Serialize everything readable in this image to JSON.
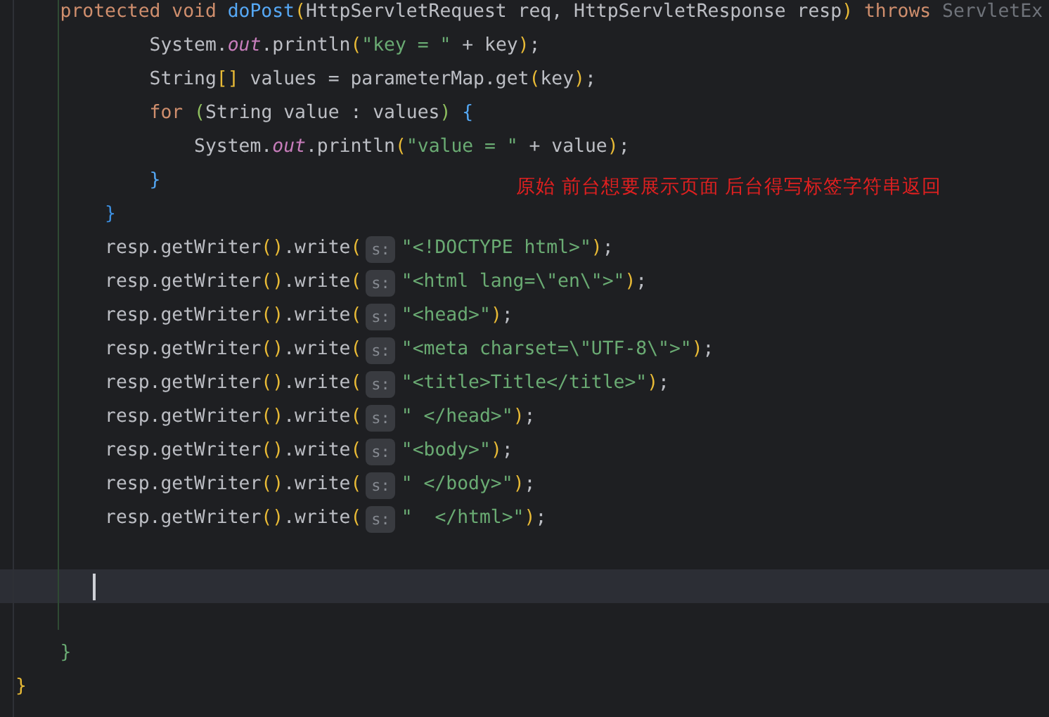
{
  "editor": {
    "lines": [
      {
        "kind": "code",
        "segments": [
          {
            "kind": "code",
            "tokens": [
              {
                "t": "    protected void ",
                "kind": "keyword"
              },
              {
                "t": "doPost",
                "kind": "method"
              },
              {
                "t": "(",
                "kind": "paren"
              },
              {
                "t": "HttpServletRequest req, HttpServletResponse resp",
                "kind": "plain"
              },
              {
                "t": ")",
                "kind": "paren"
              },
              {
                "t": " throws ",
                "kind": "keyword"
              },
              {
                "t": "ServletEx",
                "kind": "dim"
              }
            ]
          }
        ]
      },
      {
        "kind": "code",
        "segments": [
          {
            "kind": "code",
            "tokens": [
              {
                "t": "            System.",
                "kind": "plain"
              },
              {
                "t": "out",
                "kind": "field"
              },
              {
                "t": ".println",
                "kind": "plain"
              },
              {
                "t": "(",
                "kind": "paren"
              },
              {
                "t": "\"key = \"",
                "kind": "string"
              },
              {
                "t": " + key",
                "kind": "plain"
              },
              {
                "t": ")",
                "kind": "paren"
              },
              {
                "t": ";",
                "kind": "plain"
              }
            ]
          }
        ]
      },
      {
        "kind": "code",
        "segments": [
          {
            "kind": "code",
            "tokens": [
              {
                "t": "            String",
                "kind": "plain"
              },
              {
                "t": "[]",
                "kind": "paren"
              },
              {
                "t": " values = parameterMap.get",
                "kind": "plain"
              },
              {
                "t": "(",
                "kind": "paren"
              },
              {
                "t": "key",
                "kind": "plain"
              },
              {
                "t": ")",
                "kind": "paren"
              },
              {
                "t": ";",
                "kind": "plain"
              }
            ]
          }
        ]
      },
      {
        "kind": "code",
        "segments": [
          {
            "kind": "code",
            "tokens": [
              {
                "t": "            for ",
                "kind": "keyword"
              },
              {
                "t": "(",
                "kind": "paren-inner"
              },
              {
                "t": "String value : values",
                "kind": "plain"
              },
              {
                "t": ")",
                "kind": "paren-inner"
              },
              {
                "t": " {",
                "kind": "brace-inner"
              }
            ]
          }
        ]
      },
      {
        "kind": "code",
        "segments": [
          {
            "kind": "code",
            "tokens": [
              {
                "t": "                System.",
                "kind": "plain"
              },
              {
                "t": "out",
                "kind": "field"
              },
              {
                "t": ".println",
                "kind": "plain"
              },
              {
                "t": "(",
                "kind": "paren"
              },
              {
                "t": "\"value = \"",
                "kind": "string"
              },
              {
                "t": " + value",
                "kind": "plain"
              },
              {
                "t": ")",
                "kind": "paren"
              },
              {
                "t": ";",
                "kind": "plain"
              }
            ]
          }
        ]
      },
      {
        "kind": "code",
        "segments": [
          {
            "kind": "code",
            "tokens": [
              {
                "t": "            }",
                "kind": "brace-inner"
              }
            ]
          }
        ]
      },
      {
        "kind": "code",
        "segments": [
          {
            "kind": "code",
            "tokens": [
              {
                "t": "        }",
                "kind": "brace-mid"
              }
            ]
          }
        ]
      },
      {
        "kind": "code",
        "segments": [
          {
            "kind": "code",
            "tokens": [
              {
                "t": "        resp.getWriter",
                "kind": "plain"
              },
              {
                "t": "()",
                "kind": "paren"
              },
              {
                "t": ".write",
                "kind": "plain"
              },
              {
                "t": "(",
                "kind": "paren"
              }
            ]
          },
          {
            "kind": "hint",
            "text": "s:"
          },
          {
            "kind": "code",
            "tokens": [
              {
                "t": "\"<!DOCTYPE html>\"",
                "kind": "string"
              },
              {
                "t": ")",
                "kind": "paren"
              },
              {
                "t": ";",
                "kind": "plain"
              }
            ]
          }
        ]
      },
      {
        "kind": "code",
        "segments": [
          {
            "kind": "code",
            "tokens": [
              {
                "t": "        resp.getWriter",
                "kind": "plain"
              },
              {
                "t": "()",
                "kind": "paren"
              },
              {
                "t": ".write",
                "kind": "plain"
              },
              {
                "t": "(",
                "kind": "paren"
              }
            ]
          },
          {
            "kind": "hint",
            "text": "s:"
          },
          {
            "kind": "code",
            "tokens": [
              {
                "t": "\"<html lang=\\\"en\\\">\"",
                "kind": "string"
              },
              {
                "t": ")",
                "kind": "paren"
              },
              {
                "t": ";",
                "kind": "plain"
              }
            ]
          }
        ]
      },
      {
        "kind": "code",
        "segments": [
          {
            "kind": "code",
            "tokens": [
              {
                "t": "        resp.getWriter",
                "kind": "plain"
              },
              {
                "t": "()",
                "kind": "paren"
              },
              {
                "t": ".write",
                "kind": "plain"
              },
              {
                "t": "(",
                "kind": "paren"
              }
            ]
          },
          {
            "kind": "hint",
            "text": "s:"
          },
          {
            "kind": "code",
            "tokens": [
              {
                "t": "\"<head>\"",
                "kind": "string"
              },
              {
                "t": ")",
                "kind": "paren"
              },
              {
                "t": ";",
                "kind": "plain"
              }
            ]
          }
        ]
      },
      {
        "kind": "code",
        "segments": [
          {
            "kind": "code",
            "tokens": [
              {
                "t": "        resp.getWriter",
                "kind": "plain"
              },
              {
                "t": "()",
                "kind": "paren"
              },
              {
                "t": ".write",
                "kind": "plain"
              },
              {
                "t": "(",
                "kind": "paren"
              }
            ]
          },
          {
            "kind": "hint",
            "text": "s:"
          },
          {
            "kind": "code",
            "tokens": [
              {
                "t": "\"<meta charset=\\\"UTF-8\\\">\"",
                "kind": "string"
              },
              {
                "t": ")",
                "kind": "paren"
              },
              {
                "t": ";",
                "kind": "plain"
              }
            ]
          }
        ]
      },
      {
        "kind": "code",
        "segments": [
          {
            "kind": "code",
            "tokens": [
              {
                "t": "        resp.getWriter",
                "kind": "plain"
              },
              {
                "t": "()",
                "kind": "paren"
              },
              {
                "t": ".write",
                "kind": "plain"
              },
              {
                "t": "(",
                "kind": "paren"
              }
            ]
          },
          {
            "kind": "hint",
            "text": "s:"
          },
          {
            "kind": "code",
            "tokens": [
              {
                "t": "\"<title>Title</title>\"",
                "kind": "string"
              },
              {
                "t": ")",
                "kind": "paren"
              },
              {
                "t": ";",
                "kind": "plain"
              }
            ]
          }
        ]
      },
      {
        "kind": "code",
        "segments": [
          {
            "kind": "code",
            "tokens": [
              {
                "t": "        resp.getWriter",
                "kind": "plain"
              },
              {
                "t": "()",
                "kind": "paren"
              },
              {
                "t": ".write",
                "kind": "plain"
              },
              {
                "t": "(",
                "kind": "paren"
              }
            ]
          },
          {
            "kind": "hint",
            "text": "s:"
          },
          {
            "kind": "code",
            "tokens": [
              {
                "t": "\" </head>\"",
                "kind": "string"
              },
              {
                "t": ")",
                "kind": "paren"
              },
              {
                "t": ";",
                "kind": "plain"
              }
            ]
          }
        ]
      },
      {
        "kind": "code",
        "segments": [
          {
            "kind": "code",
            "tokens": [
              {
                "t": "        resp.getWriter",
                "kind": "plain"
              },
              {
                "t": "()",
                "kind": "paren"
              },
              {
                "t": ".write",
                "kind": "plain"
              },
              {
                "t": "(",
                "kind": "paren"
              }
            ]
          },
          {
            "kind": "hint",
            "text": "s:"
          },
          {
            "kind": "code",
            "tokens": [
              {
                "t": "\"<body>\"",
                "kind": "string"
              },
              {
                "t": ")",
                "kind": "paren"
              },
              {
                "t": ";",
                "kind": "plain"
              }
            ]
          }
        ]
      },
      {
        "kind": "code",
        "segments": [
          {
            "kind": "code",
            "tokens": [
              {
                "t": "        resp.getWriter",
                "kind": "plain"
              },
              {
                "t": "()",
                "kind": "paren"
              },
              {
                "t": ".write",
                "kind": "plain"
              },
              {
                "t": "(",
                "kind": "paren"
              }
            ]
          },
          {
            "kind": "hint",
            "text": "s:"
          },
          {
            "kind": "code",
            "tokens": [
              {
                "t": "\" </body>\"",
                "kind": "string"
              },
              {
                "t": ")",
                "kind": "paren"
              },
              {
                "t": ";",
                "kind": "plain"
              }
            ]
          }
        ]
      },
      {
        "kind": "code",
        "segments": [
          {
            "kind": "code",
            "tokens": [
              {
                "t": "        resp.getWriter",
                "kind": "plain"
              },
              {
                "t": "()",
                "kind": "paren"
              },
              {
                "t": ".write",
                "kind": "plain"
              },
              {
                "t": "(",
                "kind": "paren"
              }
            ]
          },
          {
            "kind": "hint",
            "text": "s:"
          },
          {
            "kind": "code",
            "tokens": [
              {
                "t": "\"  </html>\"",
                "kind": "string"
              },
              {
                "t": ")",
                "kind": "paren"
              },
              {
                "t": ";",
                "kind": "plain"
              }
            ]
          }
        ]
      },
      {
        "kind": "blank"
      },
      {
        "kind": "cursor"
      },
      {
        "kind": "blank"
      },
      {
        "kind": "code",
        "segments": [
          {
            "kind": "code",
            "tokens": [
              {
                "t": "    }",
                "kind": "brace-outer"
              }
            ]
          }
        ]
      },
      {
        "kind": "code",
        "segments": [
          {
            "kind": "code",
            "tokens": [
              {
                "t": "}",
                "kind": "brace-root"
              }
            ]
          }
        ]
      }
    ]
  },
  "annotation": {
    "text": "原始 前台想要展示页面 后台得写标签字符串返回"
  }
}
